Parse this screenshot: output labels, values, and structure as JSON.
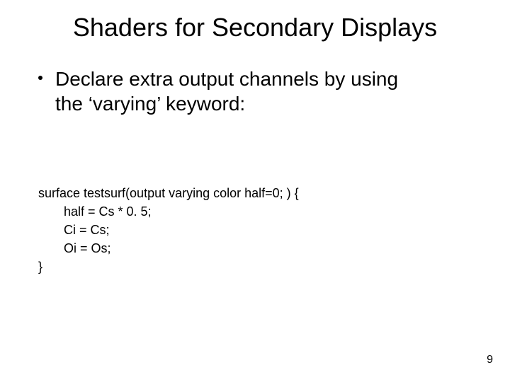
{
  "title": "Shaders for Secondary Displays",
  "bullet": {
    "line1": "Declare extra output channels by using",
    "line2": "the ‘varying’ keyword:"
  },
  "code": {
    "l1": "surface testsurf(output varying color half=0; ) {",
    "l2": "half = Cs * 0. 5;",
    "l3": "Ci = Cs;",
    "l4": "Oi = Os;",
    "l5": "}"
  },
  "page_number": "9"
}
